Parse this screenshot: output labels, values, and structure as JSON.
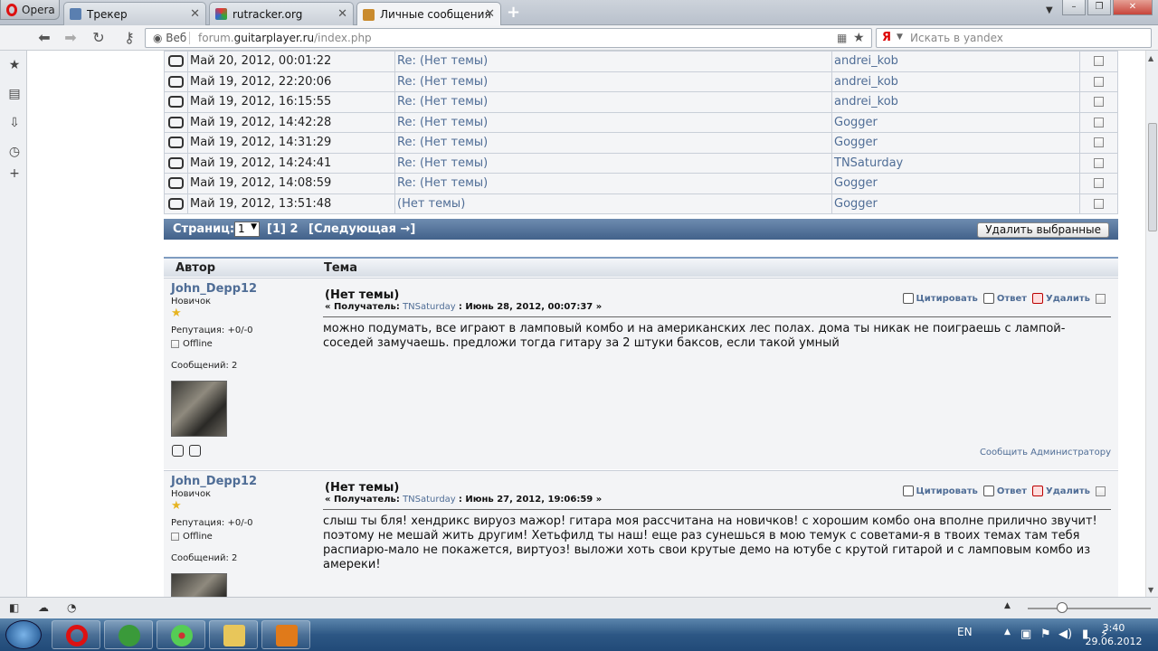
{
  "browser": {
    "menu_label": "Opera",
    "tabs": [
      {
        "title": "Трекер"
      },
      {
        "title": "rutracker.org"
      },
      {
        "title": "Личные сообщения"
      }
    ],
    "new_tab": "+",
    "web_label": "Веб",
    "url_prefix": "forum.",
    "url_domain": "guitarplayer.ru",
    "url_path": "/index.php",
    "search_placeholder": "Искать в yandex",
    "search_engine_glyph": "Я"
  },
  "pm_list": {
    "rows": [
      {
        "icon": "replied",
        "date": "Май 20, 2012, 00:01:22",
        "subject": "Re: (Нет темы)",
        "from": "andrei_kob"
      },
      {
        "icon": "replied",
        "date": "Май 19, 2012, 22:20:06",
        "subject": "Re: (Нет темы)",
        "from": "andrei_kob"
      },
      {
        "icon": "replied",
        "date": "Май 19, 2012, 16:15:55",
        "subject": "Re: (Нет темы)",
        "from": "andrei_kob"
      },
      {
        "icon": "read",
        "date": "Май 19, 2012, 14:42:28",
        "subject": "Re: (Нет темы)",
        "from": "Gogger"
      },
      {
        "icon": "replied",
        "date": "Май 19, 2012, 14:31:29",
        "subject": "Re: (Нет темы)",
        "from": "Gogger"
      },
      {
        "icon": "read",
        "date": "Май 19, 2012, 14:24:41",
        "subject": "Re: (Нет темы)",
        "from": "TNSaturday"
      },
      {
        "icon": "replied",
        "date": "Май 19, 2012, 14:08:59",
        "subject": "Re: (Нет темы)",
        "from": "Gogger"
      },
      {
        "icon": "replied",
        "date": "Май 19, 2012, 13:51:48",
        "subject": "(Нет темы)",
        "from": "Gogger"
      }
    ],
    "pages_label": "Страниц:",
    "page_select_value": "1",
    "pages_text": "[1] 2",
    "next_label": "[Следующая →]",
    "delete_selected": "Удалить выбранные"
  },
  "messages_header": {
    "author": "Автор",
    "topic": "Тема"
  },
  "posts": [
    {
      "author": "John_Depp12",
      "rank": "Новичок",
      "reputation": "Репутация: +0/-0",
      "status": "Offline",
      "post_count": "Сообщений: 2",
      "subject": "(Нет темы)",
      "recipient_label": "« Получатель:",
      "recipient": "TNSaturday",
      "date": ": Июнь 28, 2012, 00:07:37 »",
      "quote": "Цитировать",
      "reply": "Ответ",
      "delete": "Удалить",
      "body": "можно подумать, все играют в ламповый комбо и на американских лес полах. дома ты никак не поиграешь с лампой-соседей замучаешь. предложи тогда гитару за 2 штуки баксов, если такой умный",
      "report": "Сообщить Администратору"
    },
    {
      "author": "John_Depp12",
      "rank": "Новичок",
      "reputation": "Репутация: +0/-0",
      "status": "Offline",
      "post_count": "Сообщений: 2",
      "subject": "(Нет темы)",
      "recipient_label": "« Получатель:",
      "recipient": "TNSaturday",
      "date": ": Июнь 27, 2012, 19:06:59 »",
      "quote": "Цитировать",
      "reply": "Ответ",
      "delete": "Удалить",
      "body": "слыш ты бля! хендрикс вируоз мажор! гитара моя рассчитана на новичков! с хорошим комбо она вполне прилично звучит!поэтому не мешай жить другим! Хетьфилд ты наш! еще раз сунешься в мою темук с советами-я в твоих темах там тебя распиарю-мало не покажется, виртуоз! выложи хоть свои крутые демо на ютубе с крутой гитарой и с ламповым комбо из амереки!"
    }
  ],
  "taskbar": {
    "lang": "EN",
    "time": "3:40",
    "date": "29.06.2012"
  },
  "colors": {
    "link": "#4f6d96",
    "header_bar": "#42618a",
    "row_bg": "#f4f5f7"
  }
}
